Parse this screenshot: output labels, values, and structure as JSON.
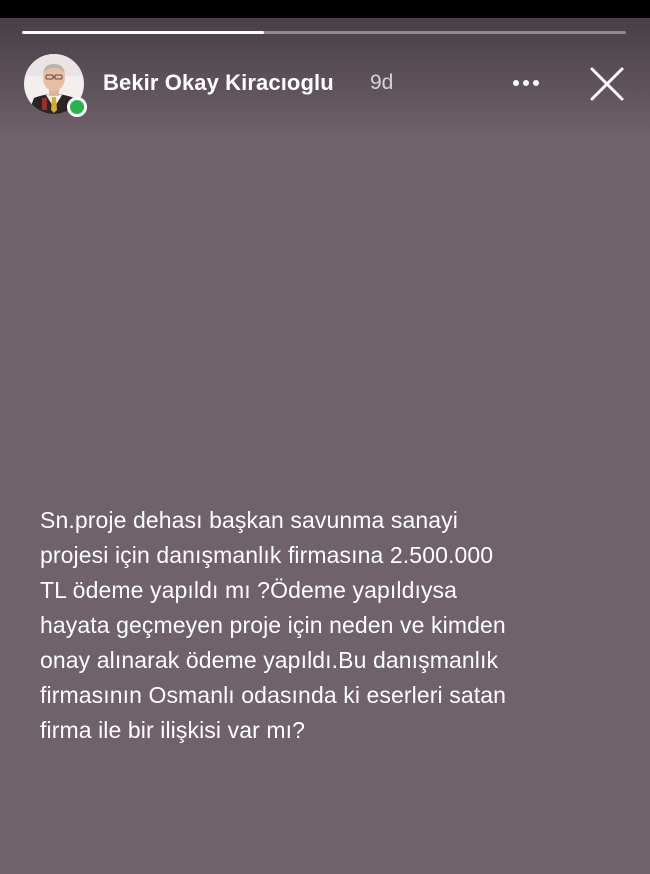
{
  "story": {
    "progress_percent": 40,
    "author": {
      "name": "Bekir Okay Kiracıoglu",
      "time_ago": "9d",
      "online": true,
      "avatar_icon": "profile-photo"
    },
    "actions": {
      "more_icon": "more-horizontal-icon",
      "close_icon": "close-icon"
    },
    "text": "Sn.proje dehası başkan savunma sanayi\nprojesi için danışmanlık firmasına 2.500.000\nTL ödeme yapıldı mı ?Ödeme yapıldıysa\nhayata geçmeyen proje için neden ve kimden\nonay alınarak ödeme yapıldı.Bu danışmanlık\nfirmasının Osmanlı odasında ki eserleri satan\nfirma ile bir ilişkisi var mı?"
  },
  "colors": {
    "background": "#6f626b",
    "online": "#2bb24c",
    "text": "#ffffff"
  }
}
